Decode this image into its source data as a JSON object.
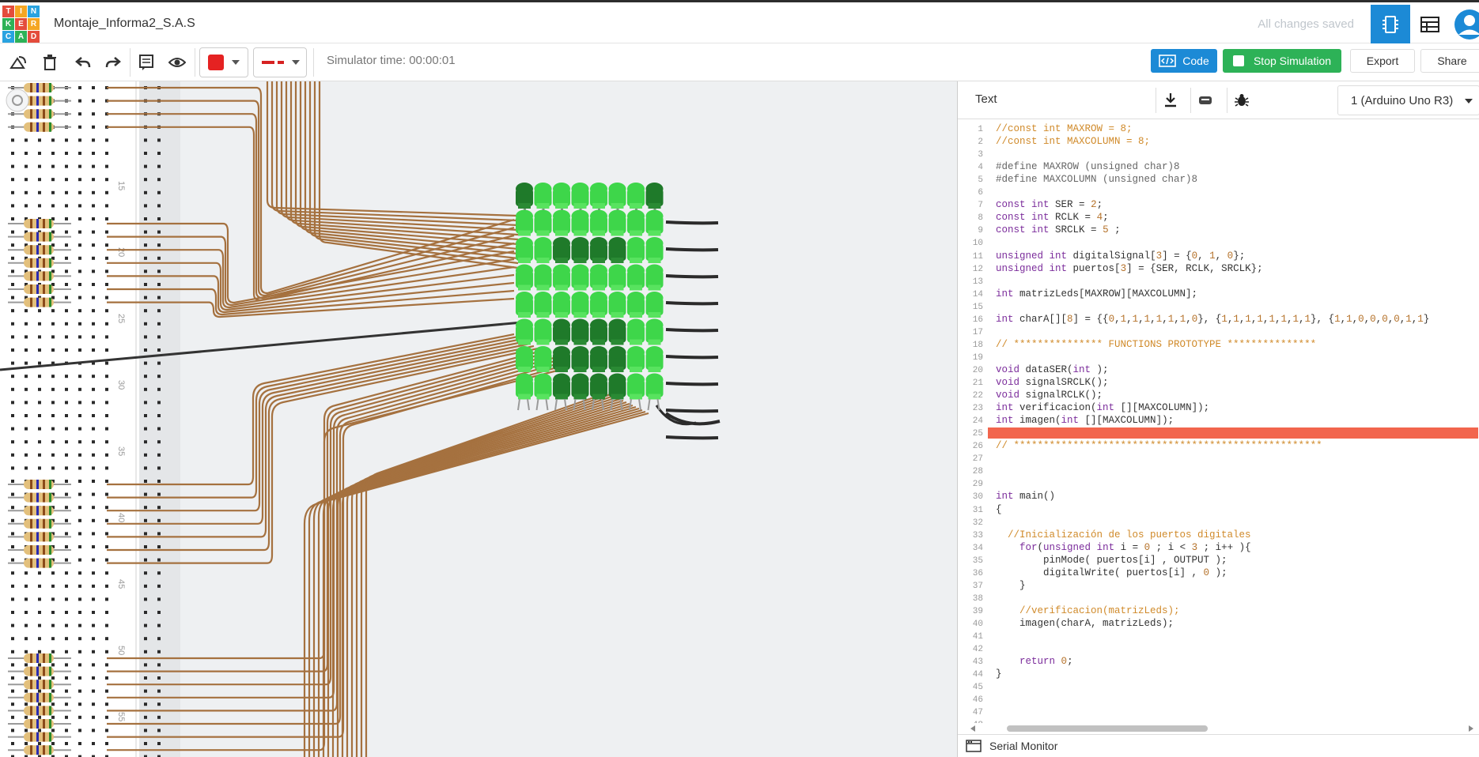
{
  "app": {
    "logo_letters": [
      "T",
      "I",
      "N",
      "K",
      "E",
      "R",
      "C",
      "A",
      "D"
    ],
    "logo_colors": [
      "#e44c3c",
      "#f5a623",
      "#29a3e0",
      "#2db257",
      "#e44c3c",
      "#f5a623",
      "#29a3e0",
      "#2db257",
      "#e44c3c"
    ],
    "project_title": "Montaje_Informa2_S.A.S",
    "save_status": "All changes saved",
    "accent_color": "#1c8ad6"
  },
  "toolbar": {
    "simulator_time": "Simulator time: 00:00:01",
    "code_label": "Code",
    "stop_label": "Stop Simulation",
    "export_label": "Export",
    "share_label": "Share",
    "fill_color": "#e52222",
    "line_color": "#d62222"
  },
  "code_panel": {
    "mode_label": "Text",
    "device_label": "1 (Arduino Uno R3)",
    "serial_label": "Serial Monitor",
    "highlight_color": "#f2654d",
    "lines": [
      "//const int MAXROW = 8;",
      "//const int MAXCOLUMN = 8;",
      "",
      "#define MAXROW (unsigned char)8",
      "#define MAXCOLUMN (unsigned char)8",
      "",
      "const int SER = 2;",
      "const int RCLK = 4;",
      "const int SRCLK = 5 ;",
      "",
      "unsigned int digitalSignal[3] = {0, 1, 0};",
      "unsigned int puertos[3] = {SER, RCLK, SRCLK};",
      "",
      "int matrizLeds[MAXROW][MAXCOLUMN];",
      "",
      "int charA[][8] = {{0,1,1,1,1,1,1,0}, {1,1,1,1,1,1,1,1}, {1,1,0,0,0,0,1,1}",
      "",
      "// *************** FUNCTIONS PROTOTYPE ***************",
      "",
      "void dataSER(int );",
      "void signalSRCLK();",
      "void signalRCLK();",
      "int verificacion(int [][MAXCOLUMN]);",
      "int imagen(int [][MAXCOLUMN]);",
      "",
      "// ****************************************************",
      "",
      "",
      "",
      "int main()",
      "{",
      "",
      "  //Inicialización de los puertos digitales",
      "    for(unsigned int i = 0 ; i < 3 ; i++ ){",
      "        pinMode( puertos[i] , OUTPUT );",
      "        digitalWrite( puertos[i] , 0 );",
      "    }",
      "",
      "    //verificacion(matrizLeds);",
      "    imagen(charA, matrizLeds);",
      "",
      "",
      "    return 0;",
      "}",
      "",
      "",
      "",
      ""
    ],
    "highlighted_line": 25
  },
  "breadboard": {
    "row_labels": [
      "15",
      "20",
      "25",
      "30",
      "35",
      "40",
      "45",
      "50",
      "55"
    ]
  },
  "led_matrix": {
    "rows": [
      [
        0,
        1,
        1,
        1,
        1,
        1,
        1,
        0
      ],
      [
        1,
        1,
        1,
        1,
        1,
        1,
        1,
        1
      ],
      [
        1,
        1,
        0,
        0,
        0,
        0,
        1,
        1
      ],
      [
        1,
        1,
        1,
        1,
        1,
        1,
        1,
        1
      ],
      [
        1,
        1,
        1,
        1,
        1,
        1,
        1,
        1
      ],
      [
        1,
        1,
        0,
        0,
        0,
        0,
        1,
        1
      ],
      [
        1,
        1,
        0,
        0,
        0,
        0,
        1,
        1
      ],
      [
        1,
        1,
        0,
        0,
        0,
        0,
        1,
        1
      ]
    ],
    "on_color": "#3ed64a",
    "off_color": "#1f7a2a"
  }
}
